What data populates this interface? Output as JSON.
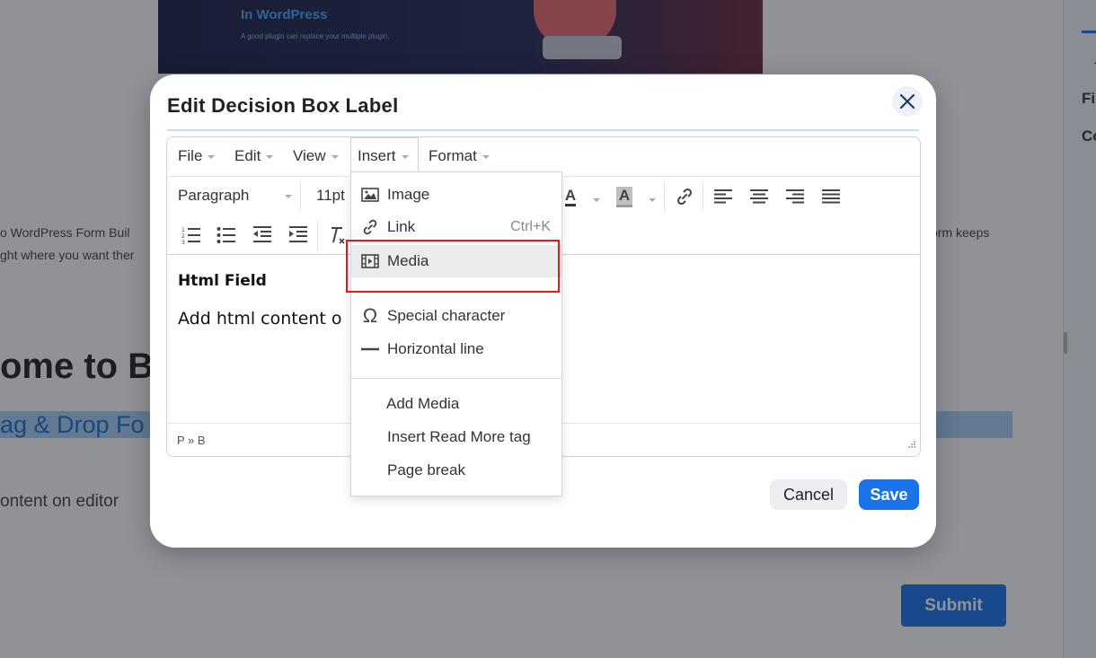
{
  "background": {
    "banner_title": "In WordPress",
    "banner_subtitle": "A good plugin can replace your multiple plugin.",
    "intro_line1": "o WordPress Form Buil",
    "intro_line2": "ght where you want ther",
    "right_text": "orm keeps",
    "heading": "ome to Bi",
    "highlight": "ag & Drop Fo",
    "content_text": "ontent on editor",
    "submit_label": "Submit",
    "side_label1": "Fi",
    "side_label2": "Co"
  },
  "modal": {
    "title": "Edit Decision Box Label",
    "cancel_label": "Cancel",
    "save_label": "Save"
  },
  "editor": {
    "menus": [
      "File",
      "Edit",
      "View",
      "Insert",
      "Format"
    ],
    "block_format": "Paragraph",
    "font_size": "11pt",
    "text_color_letter": "A",
    "bg_color_letter": "A",
    "content_heading": "Html Field",
    "content_text": "Add html content o",
    "status_path": "P » B"
  },
  "insert_menu": {
    "items": [
      {
        "label": "Image",
        "icon": "image-icon",
        "shortcut": ""
      },
      {
        "label": "Link",
        "icon": "link-icon",
        "shortcut": "Ctrl+K"
      },
      {
        "label": "Media",
        "icon": "media-icon",
        "shortcut": ""
      },
      {
        "label": "Special character",
        "icon": "omega-icon",
        "shortcut": ""
      },
      {
        "label": "Horizontal line",
        "icon": "horizontal-line-icon",
        "shortcut": ""
      },
      {
        "label": "Add Media",
        "icon": "",
        "shortcut": ""
      },
      {
        "label": "Insert Read More tag",
        "icon": "",
        "shortcut": ""
      },
      {
        "label": "Page break",
        "icon": "",
        "shortcut": ""
      }
    ],
    "highlighted": "Media"
  },
  "colors": {
    "accent": "#1a73e8",
    "highlight_box": "#e01b1b"
  }
}
